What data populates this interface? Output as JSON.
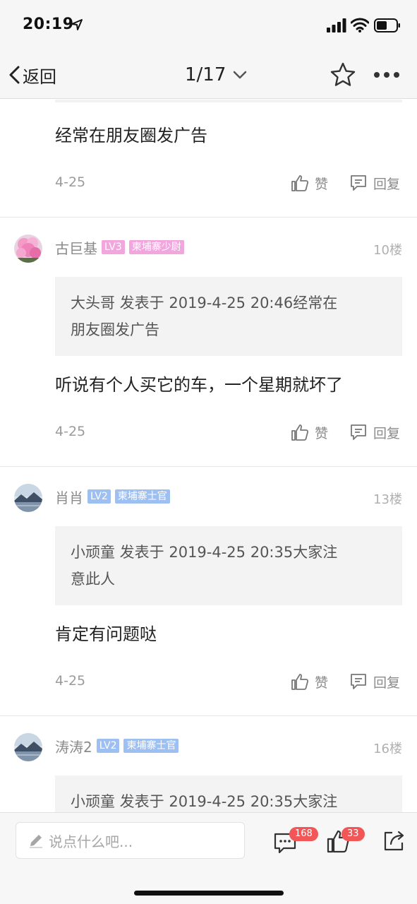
{
  "status_bar": {
    "time": "20:19"
  },
  "nav": {
    "back_label": "返回",
    "page_indicator": "1/17"
  },
  "partial_post": {
    "text": "经常在朋友圈发广告",
    "date": "4-25",
    "like_label": "赞",
    "reply_label": "回复"
  },
  "posts": [
    {
      "username": "古巨基",
      "level": "LV3",
      "title": "柬埔寨少尉",
      "floor": "10楼",
      "quote_line1": "大头哥 发表于 2019-4-25 20:46经常在",
      "quote_line2": "朋友圈发广告",
      "text": "听说有个人买它的车，一个星期就坏了",
      "date": "4-25",
      "like_label": "赞",
      "reply_label": "回复"
    },
    {
      "username": "肖肖",
      "level": "LV2",
      "title": "柬埔寨士官",
      "floor": "13楼",
      "quote_line1": "小顽童 发表于 2019-4-25 20:35大家注",
      "quote_line2": "意此人",
      "text": "肯定有问题哒",
      "date": "4-25",
      "like_label": "赞",
      "reply_label": "回复"
    },
    {
      "username": "涛涛2",
      "level": "LV2",
      "title": "柬埔寨士官",
      "floor": "16楼",
      "quote_line1": "小顽童 发表于 2019-4-25 20:35大家注"
    }
  ],
  "bottom_bar": {
    "input_placeholder": "说点什么吧...",
    "comment_count": "168",
    "like_count": "33"
  },
  "colors": {
    "badge_pink": "#f2a6de",
    "badge_blue": "#9ebff2",
    "count_badge": "#f25656"
  }
}
